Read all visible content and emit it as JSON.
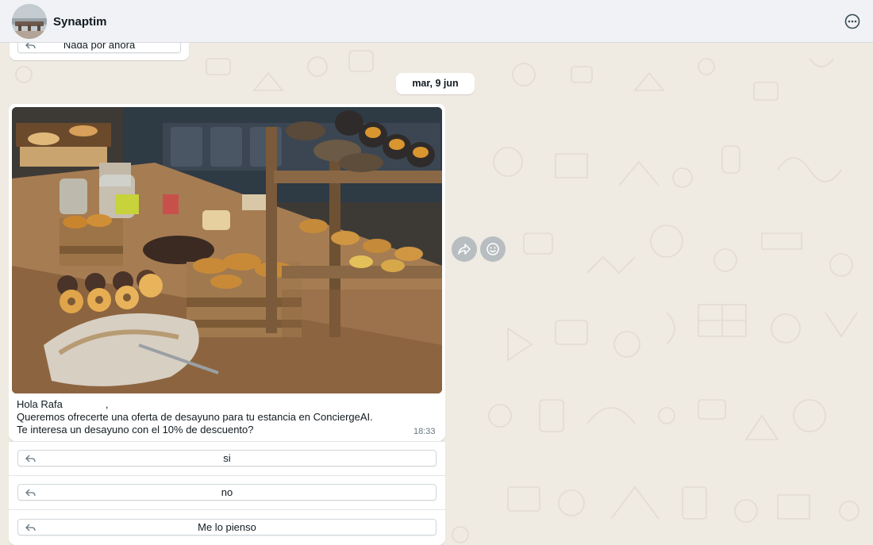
{
  "header": {
    "contact_name": "Synaptim"
  },
  "previous_message": {
    "quick_reply": "Nada por ahora"
  },
  "date_separator": "mar, 9 jun",
  "message": {
    "greeting": "Hola Rafa",
    "greeting_suffix": ",",
    "line2": "Queremos ofrecerte una oferta de desayuno para tu estancia en ConciergeAI.",
    "line3": "Te interesa un desayuno con el 10% de descuento?",
    "time": "18:33"
  },
  "quick_replies": [
    {
      "label": "si"
    },
    {
      "label": "no"
    },
    {
      "label": "Me lo pienso"
    }
  ],
  "icons": {
    "header_menu": "more-options-icon",
    "forward": "forward-icon",
    "react": "emoji-icon",
    "reply": "reply-arrow-icon"
  },
  "colors": {
    "chat_background": "#efeae2",
    "header_background": "#f0f2f5",
    "bubble": "#ffffff",
    "timestamp": "#667781"
  }
}
